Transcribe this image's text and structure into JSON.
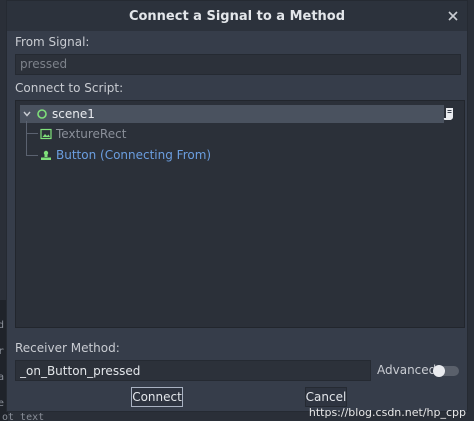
{
  "dialog": {
    "title": "Connect a Signal to a Method"
  },
  "from_signal": {
    "label": "From Signal:",
    "value": "pressed"
  },
  "connect_to_script": {
    "label": "Connect to Script:"
  },
  "tree": {
    "root": {
      "name": "scene1",
      "icon": "node-circle-icon"
    },
    "children": [
      {
        "name": "TextureRect",
        "icon": "texture-rect-icon",
        "color": "#8a8f99"
      },
      {
        "name": "Button (Connecting From)",
        "icon": "button-node-icon",
        "color": "#6b9ee0"
      }
    ]
  },
  "receiver": {
    "label": "Receiver Method:",
    "value": "_on_Button_pressed"
  },
  "advanced": {
    "label": "Advanced",
    "enabled": false
  },
  "buttons": {
    "connect": "Connect",
    "cancel": "Cancel"
  },
  "watermark": "https://blog.csdn.net/hp_cpp",
  "background_editor": {
    "bottom_text": "ot_text"
  },
  "colors": {
    "accent_green": "#7fe07a",
    "child_link_blue": "#6b9ee0",
    "selection_bg": "#4a525f"
  }
}
